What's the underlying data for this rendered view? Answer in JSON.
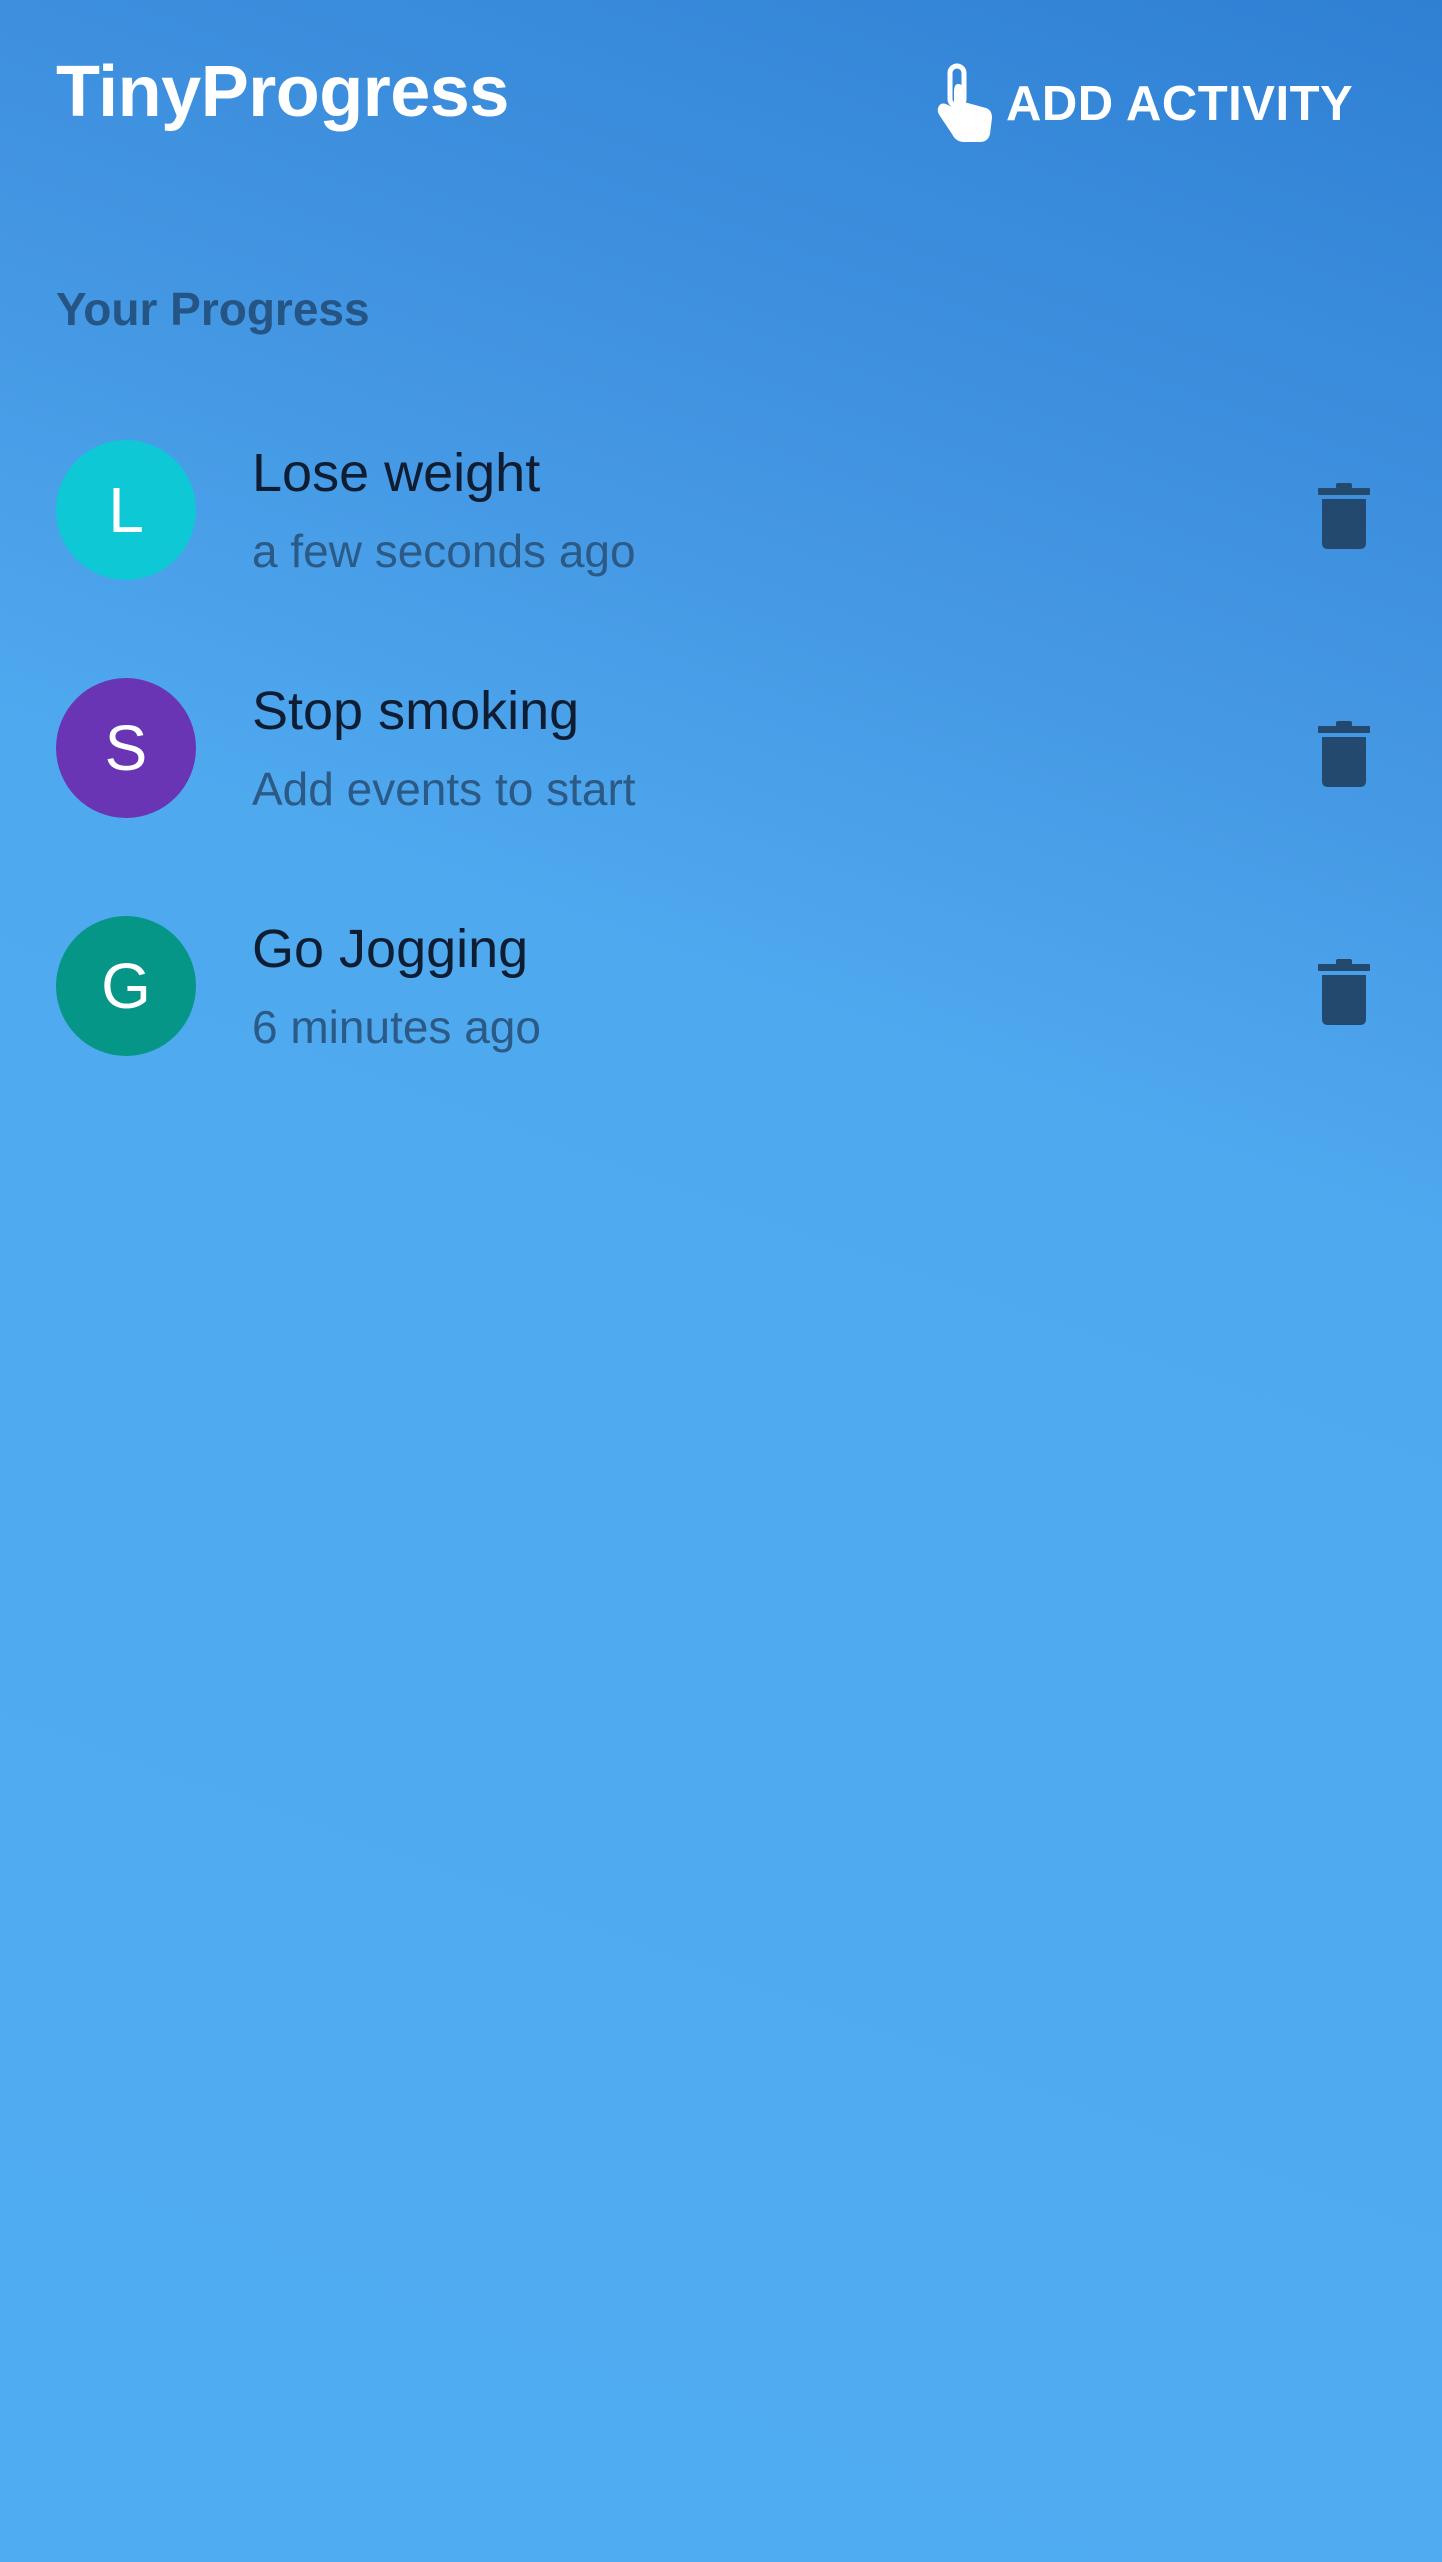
{
  "app_bar": {
    "title": "TinyProgress",
    "add_activity_label": "ADD ACTIVITY",
    "add_activity_icon": "touch-hand-icon"
  },
  "section": {
    "title": "Your Progress"
  },
  "activities": [
    {
      "initial": "L",
      "name": "Lose weight",
      "subtitle": "a few seconds ago",
      "avatar_color": "#0ec8d6",
      "action_icon": "trash-icon"
    },
    {
      "initial": "S",
      "name": "Stop smoking",
      "subtitle": "Add events to start",
      "avatar_color": "#6a35b4",
      "action_icon": "trash-icon"
    },
    {
      "initial": "G",
      "name": "Go Jogging",
      "subtitle": "6 minutes ago",
      "avatar_color": "#069688",
      "action_icon": "trash-icon"
    }
  ],
  "colors": {
    "background_top": "#2f80d4",
    "background_bottom": "#50acf2",
    "section_title": "#255585",
    "item_title": "#0f1d33",
    "item_subtitle": "#2b5a86",
    "trash_icon": "#23496e"
  }
}
